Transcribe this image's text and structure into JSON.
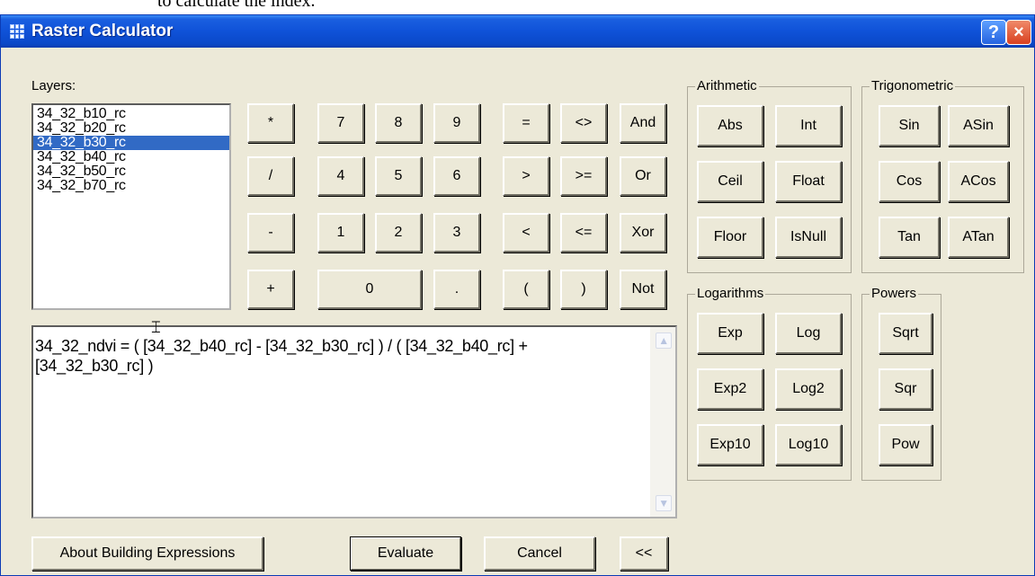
{
  "doc_text": "to calculate the index.",
  "window": {
    "title": "Raster Calculator",
    "help_label": "?",
    "close_label": "×"
  },
  "layers": {
    "label": "Layers:",
    "items": [
      "34_32_b10_rc",
      "34_32_b20_rc",
      "34_32_b30_rc",
      "34_32_b40_rc",
      "34_32_b50_rc",
      "34_32_b70_rc"
    ],
    "selected_index": 2
  },
  "operators": {
    "multiply": "*",
    "divide": "/",
    "minus": "-",
    "plus": "+",
    "n7": "7",
    "n8": "8",
    "n9": "9",
    "n4": "4",
    "n5": "5",
    "n6": "6",
    "n1": "1",
    "n2": "2",
    "n3": "3",
    "n0": "0",
    "dot": ".",
    "eq": "=",
    "ne": "<>",
    "and": "And",
    "gt": ">",
    "ge": ">=",
    "or": "Or",
    "lt": "<",
    "le": "<=",
    "xor": "Xor",
    "lparen": "(",
    "rparen": ")",
    "not": "Not"
  },
  "arithmetic": {
    "label": "Arithmetic",
    "buttons": [
      "Abs",
      "Int",
      "Ceil",
      "Float",
      "Floor",
      "IsNull"
    ]
  },
  "trigonometric": {
    "label": "Trigonometric",
    "buttons": [
      "Sin",
      "ASin",
      "Cos",
      "ACos",
      "Tan",
      "ATan"
    ]
  },
  "logarithms": {
    "label": "Logarithms",
    "buttons": [
      "Exp",
      "Log",
      "Exp2",
      "Log2",
      "Exp10",
      "Log10"
    ]
  },
  "powers": {
    "label": "Powers",
    "buttons": [
      "Sqrt",
      "Sqr",
      "Pow"
    ]
  },
  "expression": "34_32_ndvi = ( [34_32_b40_rc] - [34_32_b30_rc] ) / ( [34_32_b40_rc] + [34_32_b30_rc] )",
  "footer": {
    "about": "About Building Expressions",
    "evaluate": "Evaluate",
    "cancel": "Cancel",
    "collapse": "<<"
  },
  "icons": {
    "title": "grid-icon",
    "scroll_up": "arrow-up-icon",
    "scroll_down": "arrow-down-icon",
    "text_cursor": "i-beam-cursor-icon"
  }
}
